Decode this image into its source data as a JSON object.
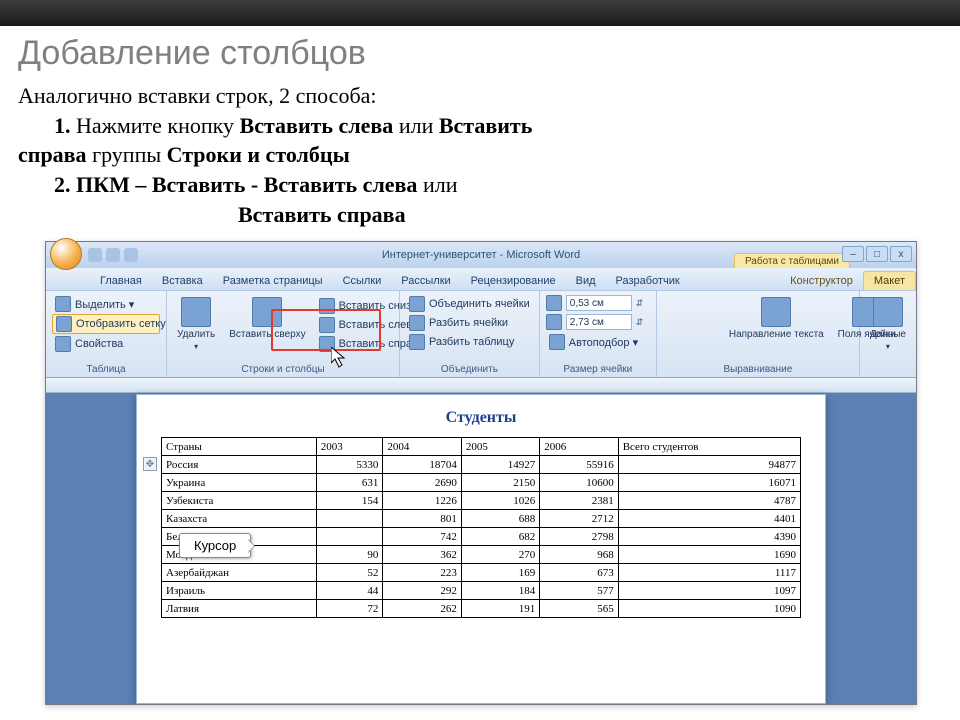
{
  "slide": {
    "title": "Добавление столбцов",
    "text": {
      "line1_a": "Аналогично вставки строк, 2 способа:",
      "line2_num": "1.",
      "line2_a": "Нажмите кнопку",
      "line2_b": "Вставить слева",
      "line2_c": "или",
      "line2_d": "Вставить",
      "line3_a": "справа",
      "line3_b": "группы",
      "line3_c": "Строки и столбцы",
      "line4_num": "2.",
      "line4_a": "ПКМ – Вставить - Вставить слева",
      "line4_b": "или",
      "line5_a": "Вставить справа"
    }
  },
  "window": {
    "title": "Интернет-университет - Microsoft Word",
    "context_tab": "Работа с таблицами",
    "tabs": [
      "Главная",
      "Вставка",
      "Разметка страницы",
      "Ссылки",
      "Рассылки",
      "Рецензирование",
      "Вид",
      "Разработчик",
      "Конструктор",
      "Макет"
    ],
    "ribbon": {
      "g1": {
        "label": "Таблица",
        "items": [
          "Выделить ▾",
          "Отобразить сетку",
          "Свойства"
        ]
      },
      "g2": {
        "label": "Строки и столбцы",
        "big1": "Удалить",
        "big2": "Вставить сверху",
        "items": [
          "Вставить снизу",
          "Вставить слева",
          "Вставить справа"
        ]
      },
      "g3": {
        "label": "Объединить",
        "items": [
          "Объединить ячейки",
          "Разбить ячейки",
          "Разбить таблицу"
        ]
      },
      "g4": {
        "label": "Размер ячейки",
        "h": "0,53 см",
        "w": "2,73 см",
        "auto": "Автоподбор ▾"
      },
      "g5": {
        "label": "Выравнивание",
        "dir": "Направление текста",
        "marg": "Поля ячейки"
      },
      "g6": {
        "label": "",
        "data": "Данные"
      }
    }
  },
  "doc": {
    "title": "Студенты",
    "tooltip": "Курсор",
    "header": [
      "Страны",
      "2003",
      "2004",
      "2005",
      "2006",
      "Всего студентов"
    ],
    "rows": [
      [
        "Россия",
        "5330",
        "18704",
        "14927",
        "55916",
        "94877"
      ],
      [
        "Украина",
        "631",
        "2690",
        "2150",
        "10600",
        "16071"
      ],
      [
        "Узбекиста",
        "154",
        "1226",
        "1026",
        "2381",
        "4787"
      ],
      [
        "Казахста",
        "",
        "801",
        "688",
        "2712",
        "4401"
      ],
      [
        "Беларус",
        "",
        "742",
        "682",
        "2798",
        "4390"
      ],
      [
        "Молдова",
        "90",
        "362",
        "270",
        "968",
        "1690"
      ],
      [
        "Азербайджан",
        "52",
        "223",
        "169",
        "673",
        "1117"
      ],
      [
        "Израиль",
        "44",
        "292",
        "184",
        "577",
        "1097"
      ],
      [
        "Латвия",
        "72",
        "262",
        "191",
        "565",
        "1090"
      ]
    ]
  }
}
